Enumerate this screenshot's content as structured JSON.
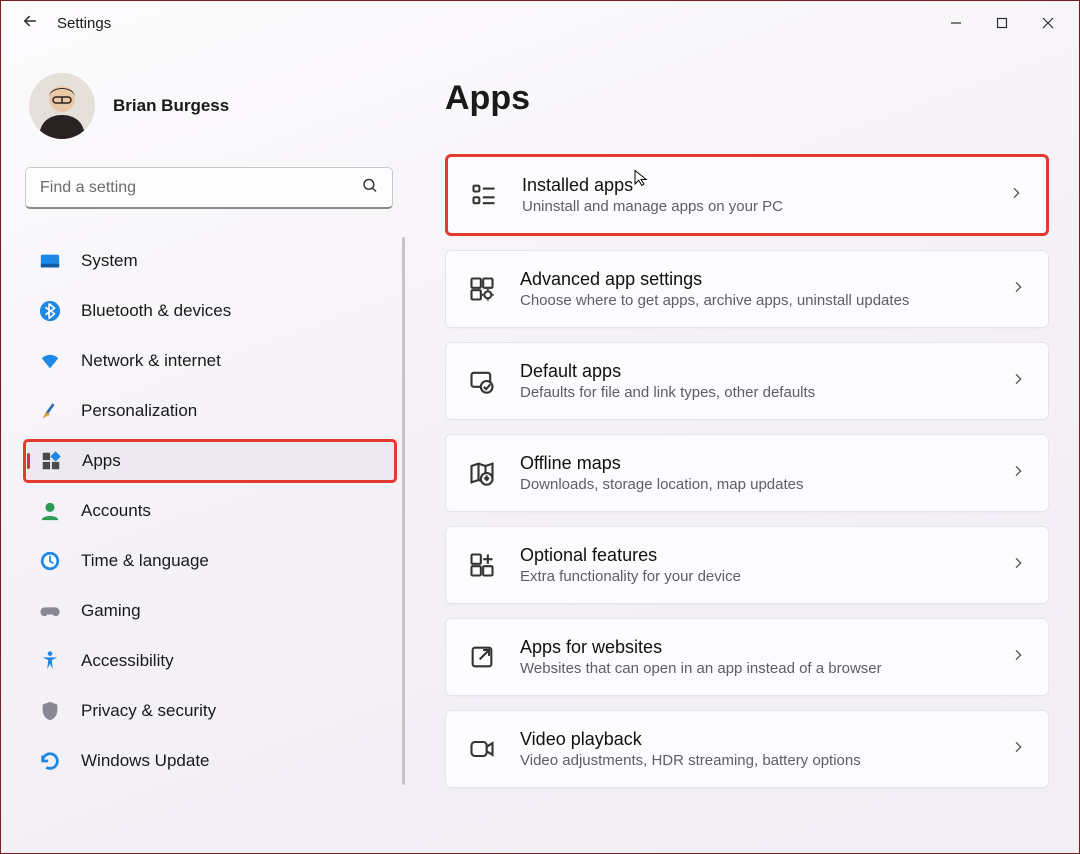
{
  "window": {
    "title": "Settings"
  },
  "profile": {
    "name": "Brian Burgess"
  },
  "search": {
    "placeholder": "Find a setting"
  },
  "nav": {
    "items": [
      {
        "label": "System"
      },
      {
        "label": "Bluetooth & devices"
      },
      {
        "label": "Network & internet"
      },
      {
        "label": "Personalization"
      },
      {
        "label": "Apps"
      },
      {
        "label": "Accounts"
      },
      {
        "label": "Time & language"
      },
      {
        "label": "Gaming"
      },
      {
        "label": "Accessibility"
      },
      {
        "label": "Privacy & security"
      },
      {
        "label": "Windows Update"
      }
    ]
  },
  "page": {
    "title": "Apps"
  },
  "cards": [
    {
      "title": "Installed apps",
      "subtitle": "Uninstall and manage apps on your PC"
    },
    {
      "title": "Advanced app settings",
      "subtitle": "Choose where to get apps, archive apps, uninstall updates"
    },
    {
      "title": "Default apps",
      "subtitle": "Defaults for file and link types, other defaults"
    },
    {
      "title": "Offline maps",
      "subtitle": "Downloads, storage location, map updates"
    },
    {
      "title": "Optional features",
      "subtitle": "Extra functionality for your device"
    },
    {
      "title": "Apps for websites",
      "subtitle": "Websites that can open in an app instead of a browser"
    },
    {
      "title": "Video playback",
      "subtitle": "Video adjustments, HDR streaming, battery options"
    }
  ],
  "colors": {
    "highlight": "#e33b2e"
  }
}
